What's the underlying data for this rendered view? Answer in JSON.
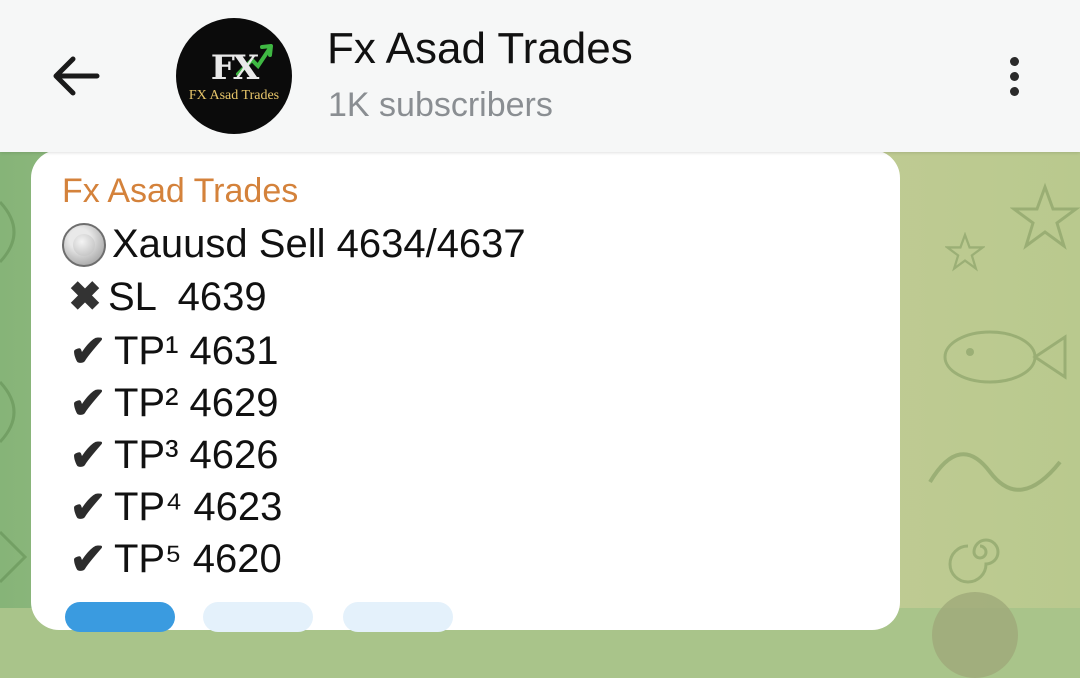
{
  "header": {
    "channel_name": "Fx Asad Trades",
    "subscribers": "1K subscribers",
    "avatar": {
      "monogram": "FX",
      "name": "FX Asad Trades"
    }
  },
  "message": {
    "sender": "Fx Asad Trades",
    "lines": [
      {
        "icon": "radio-button-icon",
        "text": "Xauusd Sell 4634/4637"
      },
      {
        "icon": "cross-mark-icon",
        "text": "SL  4639"
      },
      {
        "icon": "check-mark-icon",
        "text": "TP¹ 4631"
      },
      {
        "icon": "check-mark-icon",
        "text": "TP² 4629"
      },
      {
        "icon": "check-mark-icon",
        "text": "TP³ 4626"
      },
      {
        "icon": "check-mark-icon",
        "text": "TP⁴ 4623"
      },
      {
        "icon": "check-mark-icon",
        "text": "TP⁵ 4620"
      }
    ]
  },
  "colors": {
    "sender": "#d4823b",
    "header_bg": "#f6f7f7",
    "subtitle": "#8a8e92",
    "chip_active": "#3a9be0",
    "chip_inactive": "#e4f1fb"
  }
}
